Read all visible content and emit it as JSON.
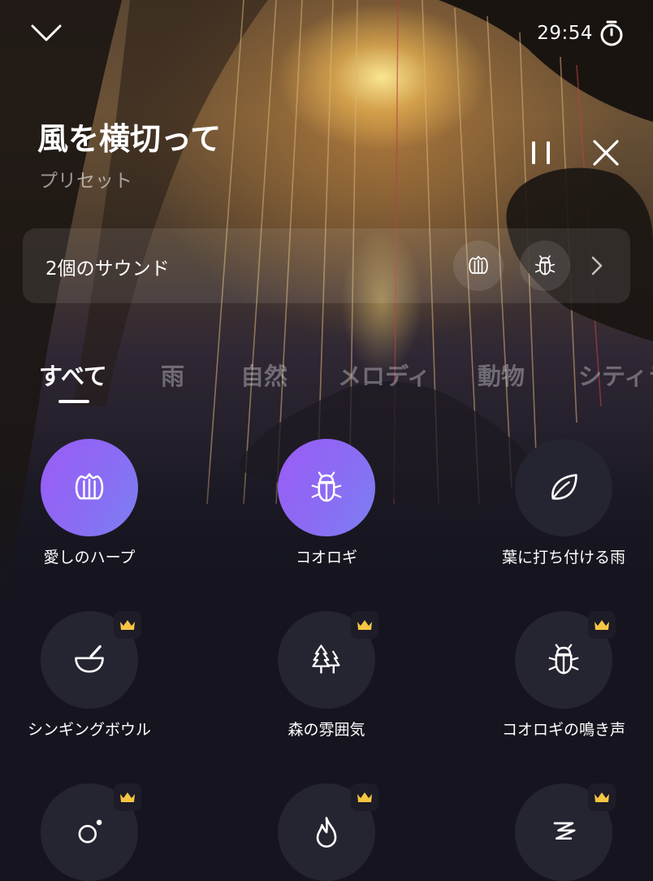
{
  "header": {
    "timer": "29:54",
    "title": "風を横切って",
    "subtitle": "プリセット"
  },
  "sounds_bar": {
    "count_label": "2個のサウンド",
    "chips": [
      "harp-icon",
      "bug-icon"
    ]
  },
  "tabs": [
    {
      "label": "すべて",
      "active": true
    },
    {
      "label": "雨",
      "active": false
    },
    {
      "label": "自然",
      "active": false
    },
    {
      "label": "メロディ",
      "active": false
    },
    {
      "label": "動物",
      "active": false
    },
    {
      "label": "シティラ",
      "active": false
    }
  ],
  "sounds": [
    {
      "label": "愛しのハープ",
      "icon": "harp-icon",
      "selected": true,
      "premium": false
    },
    {
      "label": "コオロギ",
      "icon": "bug-icon",
      "selected": true,
      "premium": false
    },
    {
      "label": "葉に打ち付ける雨",
      "icon": "leaf-icon",
      "selected": false,
      "premium": false
    },
    {
      "label": "シンギングボウル",
      "icon": "singing-bowl-icon",
      "selected": false,
      "premium": true
    },
    {
      "label": "森の雰囲気",
      "icon": "forest-icon",
      "selected": false,
      "premium": true
    },
    {
      "label": "コオロギの鳴き声",
      "icon": "bug-icon",
      "selected": false,
      "premium": true
    },
    {
      "label": "",
      "icon": "sun-icon",
      "selected": false,
      "premium": true
    },
    {
      "label": "",
      "icon": "flame-icon",
      "selected": false,
      "premium": true
    },
    {
      "label": "",
      "icon": "wind-icon",
      "selected": false,
      "premium": true
    }
  ],
  "colors": {
    "accent_gradient_start": "#9b5cf6",
    "accent_gradient_end": "#7b80f2",
    "crown": "#f5c542",
    "background": "#16151f"
  }
}
